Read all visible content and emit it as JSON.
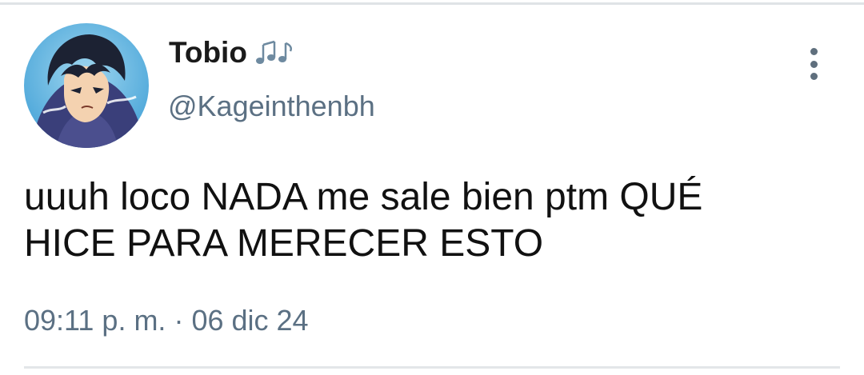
{
  "user": {
    "display_name": "Tobio",
    "name_emoji": "music-notes-icon",
    "handle": "@Kageinthenbh",
    "avatar": "anime-character-avatar"
  },
  "tweet": {
    "text_lines": [
      "uuuh loco NADA me sale bien ptm QUÉ",
      "HICE PARA MERECER ESTO"
    ],
    "time": "09:11 p. m.",
    "separator": "·",
    "date": "06 dic 24"
  },
  "icons": {
    "more": "more-vertical-icon"
  },
  "colors": {
    "name": "#1a1a1a",
    "secondary": "#5b7083",
    "body_text": "#111111",
    "divider": "#dfe3e6"
  }
}
